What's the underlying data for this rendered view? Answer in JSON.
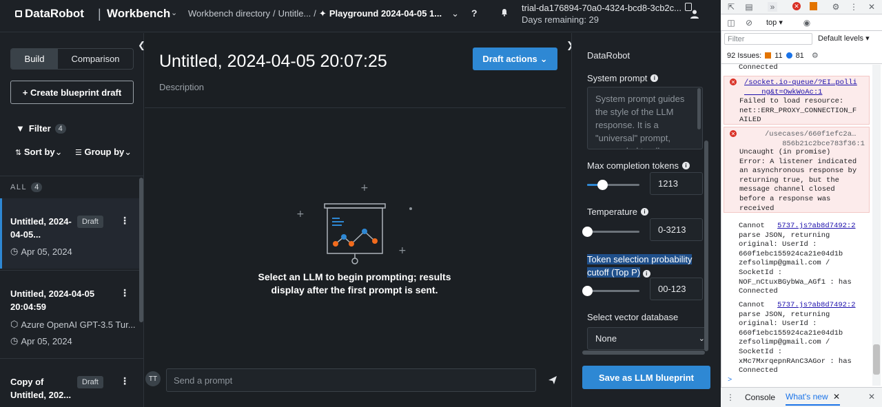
{
  "topbar": {
    "brand": "DataRobot",
    "separator": "|",
    "product": "Workbench",
    "breadcrumb": {
      "directory": "Workbench directory",
      "sep1": "/",
      "usecase": "Untitle...",
      "sep2": "/",
      "current": "Playground 2024-04-05 1..."
    },
    "help_label": "?",
    "trial_id": "trial-da176894-70a0-4324-bcd8-3cb2c...",
    "days_remaining": "Days remaining: 29"
  },
  "left": {
    "tabs": [
      "Build",
      "Comparison"
    ],
    "create_label": "+ Create blueprint draft",
    "filter_label": "Filter",
    "filter_count": "4",
    "sort_label": "Sort by",
    "group_label": "Group by",
    "all_label": "ALL",
    "all_count": "4",
    "cards": [
      {
        "title": "Untitled, 2024-04-05...",
        "tag": "Draft",
        "date": "Apr 05, 2024"
      },
      {
        "title": "Untitled, 2024-04-05 20:04:59",
        "model": "Azure OpenAI GPT-3.5 Tur...",
        "date": "Apr 05, 2024"
      },
      {
        "title": "Copy of Untitled, 202...",
        "tag": "Draft"
      }
    ]
  },
  "main": {
    "title": "Untitled, 2024-04-05 20:07:25",
    "description": "Description",
    "draft_actions": "Draft actions",
    "empty_line1": "Select an LLM to begin prompting; results",
    "empty_line2": "display after the first prompt is sent.",
    "avatar_initials": "TT",
    "prompt_placeholder": "Send a prompt"
  },
  "config": {
    "heading": "DataRobot",
    "system_prompt_label": "System prompt",
    "system_prompt_placeholder": "System prompt guides the style of the LLM response. It is a \"universal\" prompt, prepended to all",
    "max_tokens_label": "Max completion tokens",
    "max_tokens_value": "1213",
    "max_tokens_fraction": 0.24,
    "temperature_label": "Temperature",
    "temperature_value": "0-3213",
    "temperature_fraction": 0.0,
    "top_p_label_1": "Token selection probability",
    "top_p_label_2": "cutoff (Top P)",
    "top_p_value": "00-123",
    "top_p_fraction": 0.0,
    "vector_db_label": "Select vector database",
    "vector_db_value": "None",
    "save_label": "Save as LLM blueprint"
  },
  "devtools": {
    "context": "top",
    "filter_placeholder": "Filter",
    "levels": "Default levels",
    "issues_label": "92 Issues:",
    "warn_count": "11",
    "info_count": "81",
    "entries": [
      {
        "type": "log",
        "text": "Connected"
      },
      {
        "type": "error",
        "link": "/socket.io-queue/?EI…polli\n    ng&t=OwkWoAc:1",
        "text": "Failed to load resource:\nnet::ERR_PROXY_CONNECTION_F\nAILED"
      },
      {
        "type": "error",
        "link": "/usecases/660f1efc2a…\n    856b21c2bce783f36:1",
        "text": "Uncaught (in promise)\nError: A listener indicated\nan asynchronous response by\nreturning true, but the\nmessage channel closed\nbefore a response was\nreceived"
      },
      {
        "type": "log",
        "prefix": "Cannot ",
        "link": "5737.js?ab8d7492:2",
        "text": "parse JSON, returning\noriginal: UserId :\n660f1ebc155924ca21e04d1b\nzefsolimp@gmail.com /\nSocketId :\nNOF_nCtuxBGybWa_AGf1 : has\nConnected"
      },
      {
        "type": "log",
        "prefix": "Cannot ",
        "link": "5737.js?ab8d7492:2",
        "text": "parse JSON, returning\noriginal: UserId :\n660f1ebc155924ca21e04d1b\nzefsolimp@gmail.com /\nSocketId :\nxMc7MxrqepnRAnC3AGor : has\nConnected"
      }
    ],
    "prompt_caret": ">",
    "tabs": [
      "Console",
      "What's new"
    ]
  },
  "colors": {
    "accent": "#2e88d4",
    "background": "#1b1f23",
    "panel": "#1d2126",
    "error_bg": "#fcebeb"
  }
}
